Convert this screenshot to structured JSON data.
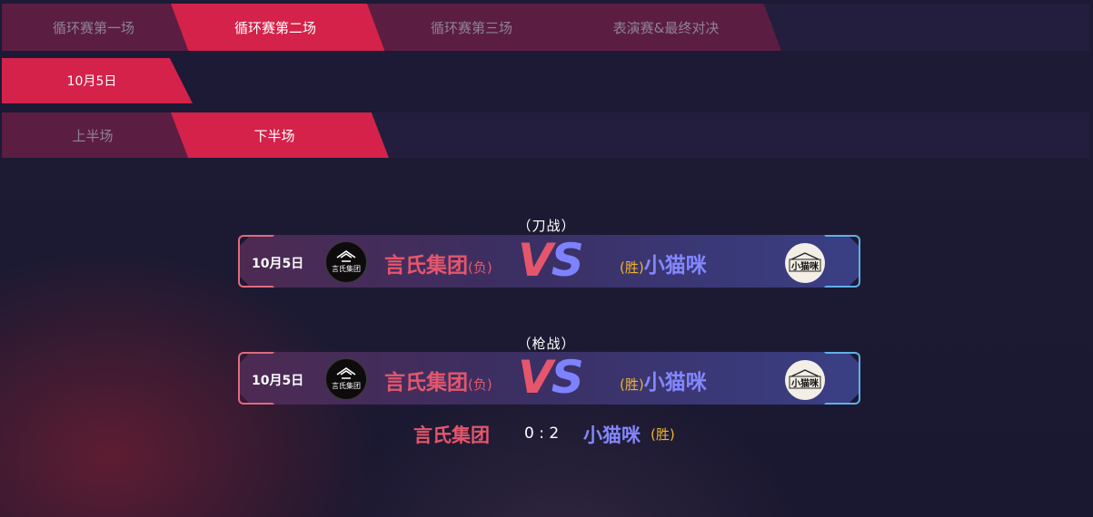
{
  "rounds": [
    "循环赛第一场",
    "循环赛第二场",
    "循环赛第三场",
    "表演赛&最终对决"
  ],
  "dates": [
    "10月5日"
  ],
  "halves": [
    "上半场",
    "下半场"
  ],
  "matches": [
    {
      "mode": "（刀战）",
      "date": "10月5日",
      "team_left": "言氏集团",
      "result_left": "(负)",
      "vs_v": "V",
      "vs_s": "S",
      "result_right": "(胜)",
      "team_right": "小猫咪"
    },
    {
      "mode": "（枪战）",
      "date": "10月5日",
      "team_left": "言氏集团",
      "result_left": "(负)",
      "vs_v": "V",
      "vs_s": "S",
      "result_right": "(胜)",
      "team_right": "小猫咪"
    }
  ],
  "logos": {
    "left_text": "言氏集团",
    "right_text": "小猫咪"
  },
  "summary": {
    "team_left": "言氏集团",
    "score": "0 : 2",
    "team_right": "小猫咪",
    "result_right": "(胜)"
  },
  "colors": {
    "active_tab": "#d4224a",
    "inactive_tab": "#5b1e42",
    "team_left": "#e5566c",
    "team_right": "#8387ff",
    "win": "#f0b429"
  }
}
